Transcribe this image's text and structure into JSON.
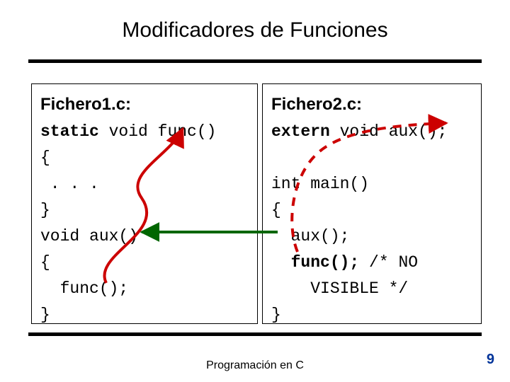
{
  "title": "Modificadores de Funciones",
  "footer": "Programación en C",
  "pagenum": "9",
  "left": {
    "header": "Fichero1.c:",
    "l1a": "static",
    "l1b": " void func()",
    "l2": "{",
    "l3": " . . .",
    "l4": "}",
    "l5": "void aux()",
    "l6": "{",
    "l7": "  func();",
    "l8": "}"
  },
  "right": {
    "header": "Fichero2.c:",
    "l1a": "extern",
    "l1b": " void aux();",
    "l2": "",
    "l3": "int main()",
    "l4": "{",
    "l5": "  aux();",
    "l6a": "  ",
    "l6b": "func();",
    "l6c": " /* NO",
    "l7": "    VISIBLE */",
    "l8": "}"
  },
  "colors": {
    "red": "#cc0000",
    "green": "#006600"
  }
}
